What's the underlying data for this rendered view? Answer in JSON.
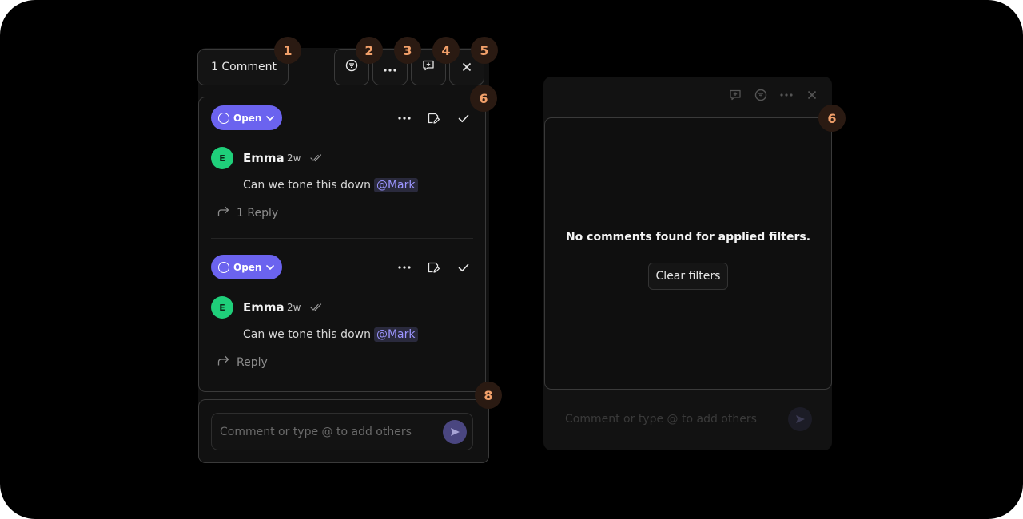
{
  "header": {
    "comment_count_label": "1 Comment"
  },
  "threads": [
    {
      "status": "Open",
      "author_initial": "E",
      "author": "Emma",
      "time": "2w",
      "message": "Can we tone this down",
      "mention": "@Mark",
      "reply_label": "1 Reply"
    },
    {
      "status": "Open",
      "author_initial": "E",
      "author": "Emma",
      "time": "2w",
      "message": "Can we tone this down",
      "mention": "@Mark",
      "reply_label": "Reply"
    }
  ],
  "composer": {
    "placeholder": "Comment or type @ to add others"
  },
  "badges": [
    "1",
    "2",
    "3",
    "4",
    "5",
    "6",
    "8"
  ],
  "empty_state": {
    "message": "No comments found for applied filters.",
    "clear_label": "Clear filters",
    "badge": "6",
    "placeholder": "Comment or type @ to add others"
  },
  "icons": {
    "filter": "filter-icon",
    "more": "more-horizontal-icon",
    "add_comment": "add-comment-icon",
    "close": "close-icon",
    "resolve": "check-icon",
    "edit_sticky": "sticky-note-edit-icon",
    "reply": "reply-arrow-icon",
    "send": "send-icon",
    "read": "double-check-icon"
  },
  "colors": {
    "accent": "#6b63ef",
    "avatar": "#1fcf7a",
    "mention": "#9c95ff",
    "badge_text": "#f2a06a"
  }
}
